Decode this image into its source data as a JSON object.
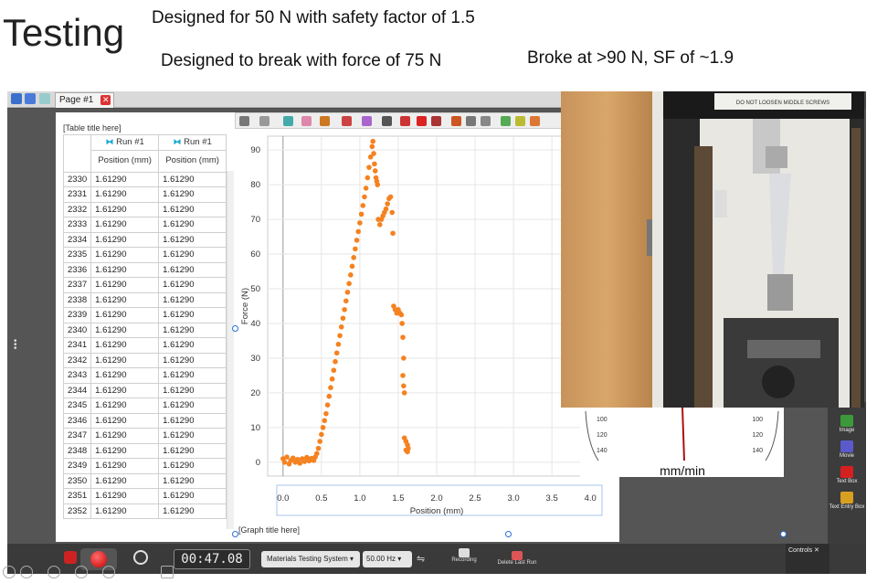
{
  "slide": {
    "title": "Testing",
    "note1": "Designed for 50 N with safety factor of 1.5",
    "note2": "Designed to break with force of 75 N",
    "note3": "Broke at >90 N, SF of ~1.9"
  },
  "app": {
    "page_tab": "Page #1",
    "table_title": "[Table title here]",
    "graph_title": "[Graph title here]",
    "table": {
      "run_label": "Run #1",
      "column_header": "Position (mm)",
      "rows": [
        {
          "idx": "2330",
          "a": "1.61290",
          "b": "1.61290"
        },
        {
          "idx": "2331",
          "a": "1.61290",
          "b": "1.61290"
        },
        {
          "idx": "2332",
          "a": "1.61290",
          "b": "1.61290"
        },
        {
          "idx": "2333",
          "a": "1.61290",
          "b": "1.61290"
        },
        {
          "idx": "2334",
          "a": "1.61290",
          "b": "1.61290"
        },
        {
          "idx": "2335",
          "a": "1.61290",
          "b": "1.61290"
        },
        {
          "idx": "2336",
          "a": "1.61290",
          "b": "1.61290"
        },
        {
          "idx": "2337",
          "a": "1.61290",
          "b": "1.61290"
        },
        {
          "idx": "2338",
          "a": "1.61290",
          "b": "1.61290"
        },
        {
          "idx": "2339",
          "a": "1.61290",
          "b": "1.61290"
        },
        {
          "idx": "2340",
          "a": "1.61290",
          "b": "1.61290"
        },
        {
          "idx": "2341",
          "a": "1.61290",
          "b": "1.61290"
        },
        {
          "idx": "2342",
          "a": "1.61290",
          "b": "1.61290"
        },
        {
          "idx": "2343",
          "a": "1.61290",
          "b": "1.61290"
        },
        {
          "idx": "2344",
          "a": "1.61290",
          "b": "1.61290"
        },
        {
          "idx": "2345",
          "a": "1.61290",
          "b": "1.61290"
        },
        {
          "idx": "2346",
          "a": "1.61290",
          "b": "1.61290"
        },
        {
          "idx": "2347",
          "a": "1.61290",
          "b": "1.61290"
        },
        {
          "idx": "2348",
          "a": "1.61290",
          "b": "1.61290"
        },
        {
          "idx": "2349",
          "a": "1.61290",
          "b": "1.61290"
        },
        {
          "idx": "2350",
          "a": "1.61290",
          "b": "1.61290"
        },
        {
          "idx": "2351",
          "a": "1.61290",
          "b": "1.61290"
        },
        {
          "idx": "2352",
          "a": "1.61290",
          "b": "1.61290"
        }
      ]
    },
    "controls": {
      "timer": "00:47.08",
      "device": "Materials Testing System",
      "rate": "50.00 Hz",
      "recording_label": "Recording",
      "delete_label": "Delete Last Run",
      "controls_panel": "Controls"
    },
    "right_panel": [
      {
        "label": "Image",
        "icon": "image-icon",
        "color": "#3a9a3a"
      },
      {
        "label": "Movie",
        "icon": "movie-icon",
        "color": "#5a5acc"
      },
      {
        "label": "Text Box",
        "icon": "text-box-icon",
        "color": "#d62020"
      },
      {
        "label": "Text Entry Box",
        "icon": "text-entry-icon",
        "color": "#d9a020"
      }
    ],
    "camera": {
      "sign": "DO NOT LOOSEN MIDDLE SCREWS"
    },
    "gauge": {
      "unit": "mm/min",
      "left_ticks": [
        "100",
        "120",
        "140"
      ],
      "right_ticks": [
        "100",
        "120",
        "140"
      ]
    }
  },
  "chart_data": {
    "type": "scatter",
    "xlabel": "Position (mm)",
    "ylabel": "Force (N)",
    "xlim": [
      -0.2,
      4.2
    ],
    "ylim": [
      -4,
      94
    ],
    "xticks": [
      "0.0",
      "0.5",
      "1.0",
      "1.5",
      "2.0",
      "2.5",
      "3.0",
      "3.5",
      "4.0"
    ],
    "yticks": [
      "0",
      "10",
      "20",
      "30",
      "40",
      "50",
      "60",
      "70",
      "80",
      "90"
    ],
    "grid": true,
    "color": "#f58220",
    "series": [
      {
        "points": [
          [
            0.0,
            1
          ],
          [
            0.02,
            0
          ],
          [
            0.05,
            1.5
          ],
          [
            0.08,
            -0.5
          ],
          [
            0.1,
            0.5
          ],
          [
            0.13,
            1.2
          ],
          [
            0.16,
            0
          ],
          [
            0.19,
            0.8
          ],
          [
            0.22,
            -0.3
          ],
          [
            0.25,
            1
          ],
          [
            0.28,
            0.2
          ],
          [
            0.31,
            1.4
          ],
          [
            0.34,
            0.4
          ],
          [
            0.37,
            1.1
          ],
          [
            0.4,
            0.5
          ],
          [
            0.42,
            1.5
          ],
          [
            0.44,
            2.5
          ],
          [
            0.46,
            4
          ],
          [
            0.48,
            6
          ],
          [
            0.5,
            8
          ],
          [
            0.52,
            10
          ],
          [
            0.54,
            12
          ],
          [
            0.56,
            14
          ],
          [
            0.58,
            16.5
          ],
          [
            0.6,
            19
          ],
          [
            0.62,
            21.5
          ],
          [
            0.64,
            24
          ],
          [
            0.66,
            26.5
          ],
          [
            0.68,
            29
          ],
          [
            0.7,
            31.5
          ],
          [
            0.72,
            34
          ],
          [
            0.74,
            36.5
          ],
          [
            0.76,
            39
          ],
          [
            0.78,
            41.5
          ],
          [
            0.8,
            44
          ],
          [
            0.82,
            46.5
          ],
          [
            0.84,
            49
          ],
          [
            0.86,
            51.5
          ],
          [
            0.88,
            54
          ],
          [
            0.9,
            56.5
          ],
          [
            0.92,
            59
          ],
          [
            0.94,
            61.5
          ],
          [
            0.96,
            64
          ],
          [
            0.98,
            66.5
          ],
          [
            1.0,
            69
          ],
          [
            1.02,
            71.5
          ],
          [
            1.04,
            74
          ],
          [
            1.06,
            76.5
          ],
          [
            1.08,
            79
          ],
          [
            1.1,
            82
          ],
          [
            1.12,
            85
          ],
          [
            1.14,
            88
          ],
          [
            1.16,
            91
          ],
          [
            1.17,
            92.5
          ],
          [
            1.18,
            89
          ],
          [
            1.19,
            86
          ],
          [
            1.2,
            84
          ],
          [
            1.21,
            82
          ],
          [
            1.22,
            81
          ],
          [
            1.23,
            80
          ],
          [
            1.24,
            70
          ],
          [
            1.26,
            68.5
          ],
          [
            1.28,
            70
          ],
          [
            1.3,
            71
          ],
          [
            1.32,
            72
          ],
          [
            1.34,
            73
          ],
          [
            1.36,
            74.5
          ],
          [
            1.38,
            76
          ],
          [
            1.4,
            76.5
          ],
          [
            1.42,
            72
          ],
          [
            1.43,
            66
          ],
          [
            1.44,
            45
          ],
          [
            1.46,
            44
          ],
          [
            1.48,
            43
          ],
          [
            1.5,
            44
          ],
          [
            1.52,
            43
          ],
          [
            1.54,
            42.5
          ],
          [
            1.55,
            40
          ],
          [
            1.56,
            36
          ],
          [
            1.57,
            30
          ],
          [
            1.56,
            25
          ],
          [
            1.57,
            22
          ],
          [
            1.58,
            20
          ],
          [
            1.58,
            7
          ],
          [
            1.6,
            6
          ],
          [
            1.62,
            5
          ],
          [
            1.63,
            4
          ],
          [
            1.6,
            3.5
          ],
          [
            1.62,
            3
          ]
        ]
      }
    ]
  }
}
